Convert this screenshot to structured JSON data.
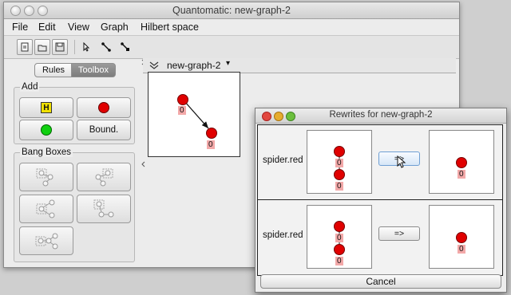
{
  "window": {
    "title": "Quantomatic: new-graph-2"
  },
  "menu": [
    "File",
    "Edit",
    "View",
    "Graph",
    "Hilbert space"
  ],
  "toolbar": {
    "icons": [
      "new-graph-icon",
      "open-icon",
      "save-icon",
      "select-tool-icon",
      "add-vertex-tool-icon",
      "add-edge-tool-icon"
    ]
  },
  "left_panel": {
    "tabs": [
      "Rules",
      "Toolbox"
    ],
    "selected_tab": "Toolbox",
    "add_group": {
      "label": "Add",
      "buttons": {
        "hadamard": "H",
        "red": "",
        "green": "",
        "boundary": "Bound."
      }
    },
    "bang_group": {
      "label": "Bang Boxes"
    }
  },
  "graph_tab": {
    "label": "new-graph-2",
    "vertex_labels": [
      "0",
      "0"
    ]
  },
  "dialog": {
    "title": "Rewrites for new-graph-2",
    "rules": [
      {
        "name": "spider.red",
        "apply_label": "=>",
        "lhs_labels": [
          "0",
          "0"
        ],
        "rhs_labels": [
          "0"
        ]
      },
      {
        "name": "spider.red",
        "apply_label": "=>",
        "lhs_labels": [
          "0",
          "0"
        ],
        "rhs_labels": [
          "0"
        ]
      }
    ],
    "cancel_label": "Cancel"
  },
  "colors": {
    "red_vertex": "#e00000",
    "green_vertex": "#10d010",
    "hadamard": "#f0e000",
    "label_bg": "#f3a9a9"
  }
}
